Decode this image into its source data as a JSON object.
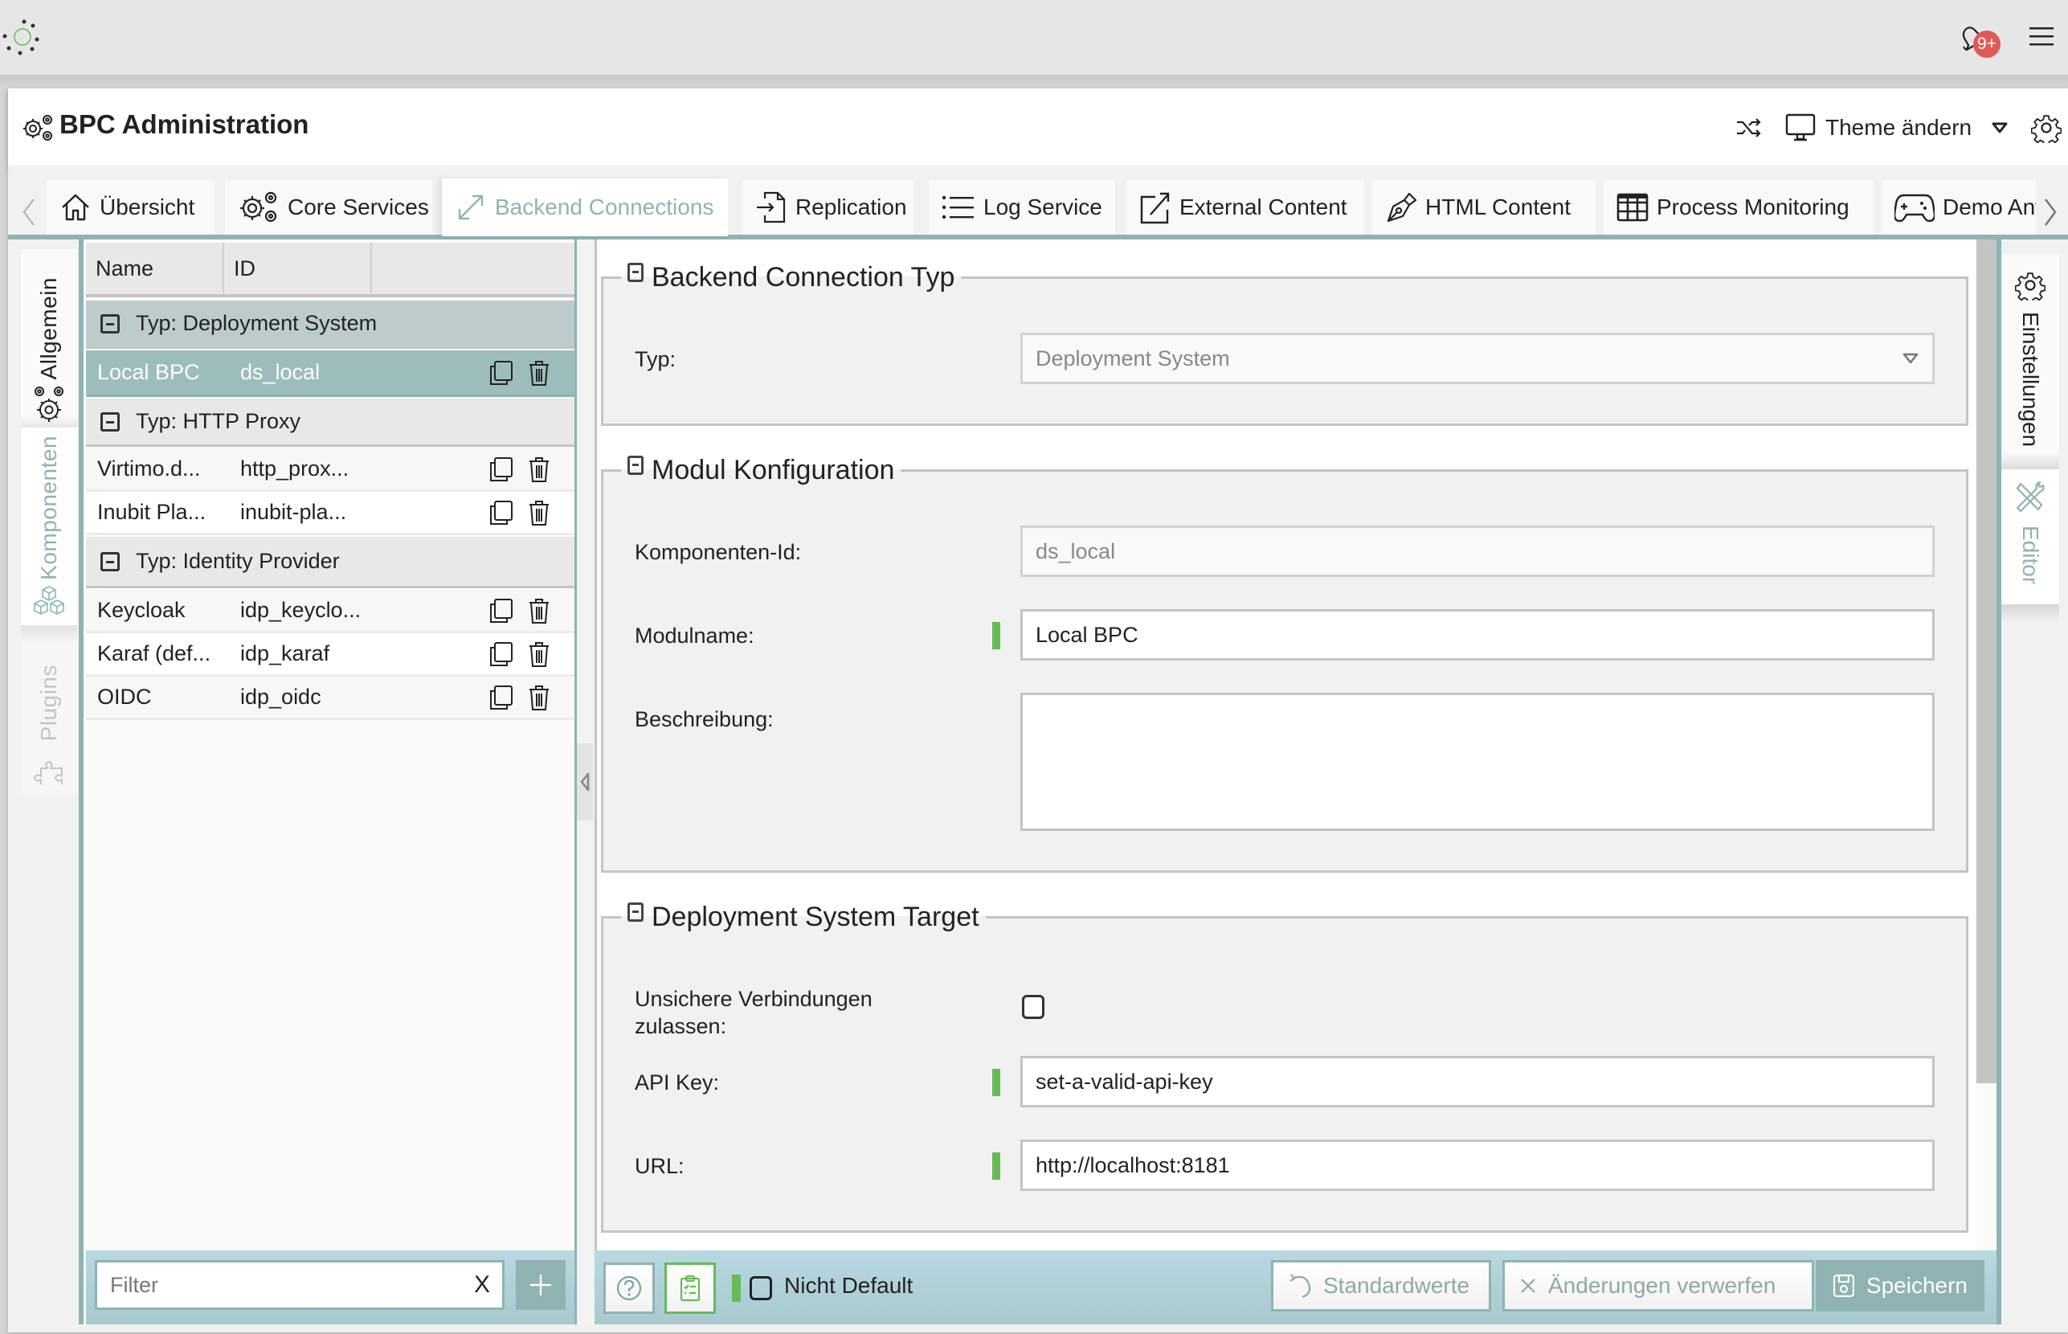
{
  "topbar": {
    "logo_icon": "spinner-logo-icon",
    "notifications": {
      "icon": "bell-icon",
      "badge": "9+"
    },
    "menu_icon": "hamburger-menu-icon"
  },
  "header": {
    "title": "BPC Administration",
    "title_icon": "gears-icon",
    "shuffle_icon": "shuffle-icon",
    "theme_label": "Theme ändern",
    "theme_icon": "monitor-icon",
    "settings_icon": "gear-icon"
  },
  "tabs": [
    {
      "label": "Übersicht",
      "icon": "home-icon",
      "active": false
    },
    {
      "label": "Core Services",
      "icon": "gears-icon",
      "active": false
    },
    {
      "label": "Backend Connections",
      "icon": "expand-arrows-icon",
      "active": true
    },
    {
      "label": "Replication",
      "icon": "file-import-icon",
      "active": false
    },
    {
      "label": "Log Service",
      "icon": "list-icon",
      "active": false
    },
    {
      "label": "External Content",
      "icon": "external-link-icon",
      "active": false
    },
    {
      "label": "HTML Content",
      "icon": "pen-nib-icon",
      "active": false
    },
    {
      "label": "Process Monitoring",
      "icon": "table-grid-icon",
      "active": false
    },
    {
      "label": "Demo Anw",
      "icon": "gamepad-icon",
      "active": false
    }
  ],
  "left_sidebar": {
    "tabs": [
      {
        "label": "Allgemein",
        "icon": "gears-icon",
        "active": false
      },
      {
        "label": "Komponenten",
        "icon": "cubes-icon",
        "active": true
      },
      {
        "label": "Plugins",
        "icon": "puzzle-icon",
        "active": false,
        "disabled": true
      }
    ]
  },
  "component_list": {
    "columns": [
      "Name",
      "ID",
      ""
    ],
    "groups": [
      {
        "label": "Typ: Deployment System",
        "rows": [
          {
            "name": "Local BPC",
            "id": "ds_local",
            "selected": true
          }
        ]
      },
      {
        "label": "Typ: HTTP Proxy",
        "rows": [
          {
            "name": "Virtimo.d...",
            "id": "http_prox...",
            "selected": false
          },
          {
            "name": "Inubit Pla...",
            "id": "inubit-pla...",
            "selected": false
          }
        ]
      },
      {
        "label": "Typ: Identity Provider",
        "rows": [
          {
            "name": "Keycloak",
            "id": "idp_keyclo...",
            "selected": false
          },
          {
            "name": "Karaf (def...",
            "id": "idp_karaf",
            "selected": false
          },
          {
            "name": "OIDC",
            "id": "idp_oidc",
            "selected": false
          }
        ]
      }
    ],
    "filter_placeholder": "Filter",
    "filter_value": "",
    "clear_label": "X",
    "add_label": "+"
  },
  "form": {
    "sections": {
      "typ": {
        "title": "Backend Connection Typ",
        "fields": {
          "typ_label": "Typ:",
          "typ_value": "Deployment System"
        }
      },
      "modul": {
        "title": "Modul Konfiguration",
        "fields": {
          "komponenten_id_label": "Komponenten-Id:",
          "komponenten_id_value": "ds_local",
          "modulname_label": "Modulname:",
          "modulname_value": "Local BPC",
          "beschreibung_label": "Beschreibung:",
          "beschreibung_value": ""
        }
      },
      "target": {
        "title": "Deployment System Target",
        "fields": {
          "unsichere_label": "Unsichere Verbindungen zulassen:",
          "unsichere_checked": false,
          "api_key_label": "API Key:",
          "api_key_value": "set-a-valid-api-key",
          "url_label": "URL:",
          "url_value": "http://localhost:8181"
        }
      }
    }
  },
  "form_footer": {
    "help_icon": "question-circle-icon",
    "clipboard_icon": "clipboard-check-icon",
    "nicht_default_label": "Nicht Default",
    "nicht_default_checked": false,
    "defaults_label": "Standardwerte",
    "discard_label": "Änderungen verwerfen",
    "save_label": "Speichern"
  },
  "right_sidebar": {
    "tabs": [
      {
        "label": "Einstellungen",
        "icon": "gear-icon",
        "active": false
      },
      {
        "label": "Editor",
        "icon": "tools-icon",
        "active": true
      }
    ]
  },
  "colors": {
    "accent": "#8fb3b2",
    "selected_row": "#9dbdbc",
    "selected_group": "#bccbcb",
    "footer_bg": "#b8d8e2",
    "required_marker": "#65bb55",
    "badge": "#e05a55"
  }
}
